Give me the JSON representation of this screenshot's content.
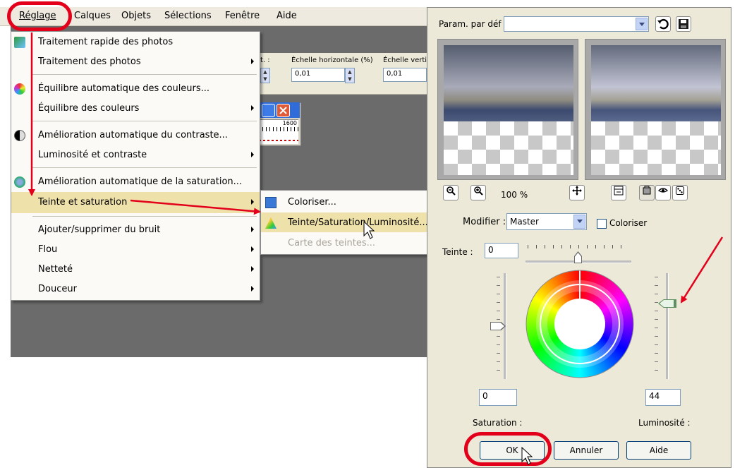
{
  "menubar": {
    "items": [
      "Réglage",
      "Calques",
      "Objets",
      "Sélections",
      "Fenêtre",
      "Aide"
    ]
  },
  "toolbar": {
    "scale_h_label": "Échelle horizontale (%)",
    "scale_v_label": "Échelle verti",
    "scale_h_value": "0,01",
    "scale_v_value": "0,01",
    "truncated_label": "t. :",
    "ruler_value": "1600"
  },
  "menu": {
    "items": [
      {
        "label": "Traitement rapide des photos",
        "submenu": false
      },
      {
        "label": "Traitement des photos",
        "submenu": true
      },
      {
        "label": "Équilibre automatique des couleurs...",
        "submenu": false
      },
      {
        "label": "Équilibre des couleurs",
        "submenu": true
      },
      {
        "label": "Amélioration automatique du contraste...",
        "submenu": false
      },
      {
        "label": "Luminosité et contraste",
        "submenu": true
      },
      {
        "label": "Amélioration automatique de la saturation...",
        "submenu": false
      },
      {
        "label": "Teinte et saturation",
        "submenu": true,
        "highlighted": true
      },
      {
        "label": "Ajouter/supprimer du bruit",
        "submenu": true
      },
      {
        "label": "Flou",
        "submenu": true
      },
      {
        "label": "Netteté",
        "submenu": true
      },
      {
        "label": "Douceur",
        "submenu": true
      }
    ]
  },
  "submenu": {
    "items": [
      {
        "label": "Coloriser...",
        "enabled": true
      },
      {
        "label": "Teinte/Saturation/Luminosité...",
        "enabled": true,
        "highlighted": true
      },
      {
        "label": "Carte des teintes...",
        "enabled": false
      }
    ]
  },
  "dialog": {
    "preset_label": "Param. par déf",
    "preset_value": "",
    "zoom_level": "100 %",
    "modifier_label": "Modifier :",
    "modifier_value": "Master",
    "colorize_label": "Coloriser",
    "colorize_checked": false,
    "hue_label": "Teinte :",
    "hue_value": "0",
    "saturation_value": "0",
    "saturation_label": "Saturation :",
    "luminosity_value": "44",
    "luminosity_label": "Luminosité :",
    "ok_label": "OK",
    "cancel_label": "Annuler",
    "help_label": "Aide"
  },
  "colors": {
    "annotation_red": "#e2001a",
    "menu_highlight": "#efe1aa",
    "dialog_bg": "#ece9d8",
    "titlebar_blue": "#2f6bd9"
  }
}
